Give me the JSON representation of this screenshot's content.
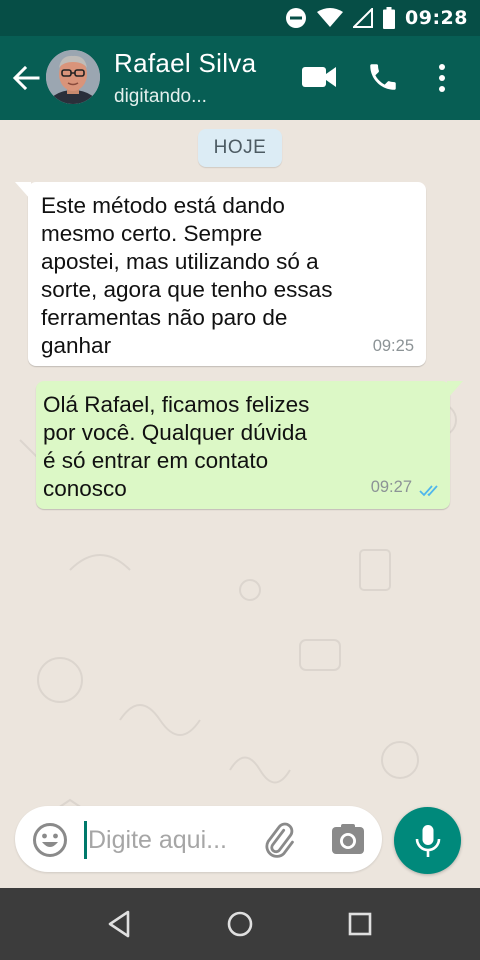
{
  "status_bar": {
    "time": "09:28"
  },
  "header": {
    "contact_name": "Rafael Silva",
    "contact_status": "digitando..."
  },
  "chat": {
    "date_chip": "HOJE",
    "messages": [
      {
        "direction": "incoming",
        "text": "Este método está dando\nmesmo certo. Sempre\napostei, mas utilizando só a\nsorte, agora que tenho essas\nferramentas não paro de\nganhar",
        "time": "09:25"
      },
      {
        "direction": "outgoing",
        "text": "Olá Rafael, ficamos felizes\npor você. Qualquer dúvida\né só entrar em contato\nconosco",
        "time": "09:27",
        "status_icon": "double-check-read-icon"
      }
    ]
  },
  "input": {
    "placeholder": "Digite aqui..."
  },
  "icons": {
    "header": [
      "back-arrow-icon",
      "video-call-icon",
      "phone-call-icon",
      "more-vert-icon"
    ],
    "input": [
      "emoji-icon",
      "paperclip-icon",
      "camera-icon",
      "mic-icon"
    ],
    "status": [
      "do-not-disturb-icon",
      "wifi-icon",
      "signal-icon",
      "battery-icon"
    ],
    "nav": [
      "nav-back-icon",
      "nav-home-icon",
      "nav-recents-icon"
    ]
  },
  "colors": {
    "header": "#075e54",
    "status_bar": "#064e46",
    "incoming_bubble": "#ffffff",
    "outgoing_bubble": "#dcf8c6",
    "accent": "#00897b",
    "read_ticks": "#4fb6ec"
  }
}
